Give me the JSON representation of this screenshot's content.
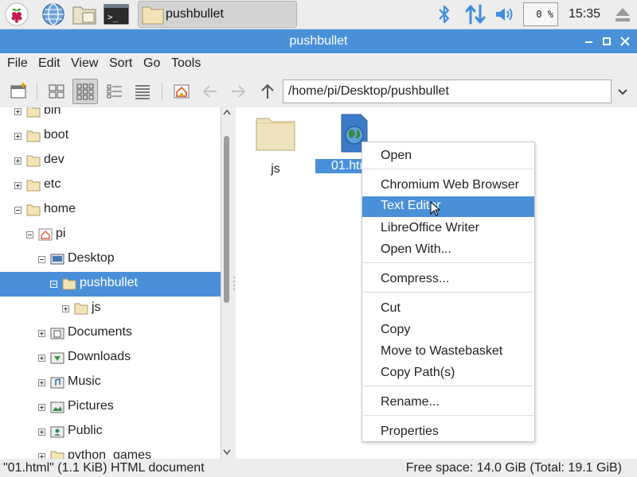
{
  "taskbar": {
    "task_label": "pushbullet",
    "cpu_label": "0 %",
    "clock": "15:35",
    "icons": [
      "raspberry-menu-icon",
      "web-browser-icon",
      "file-manager-icon",
      "terminal-icon",
      "bluetooth-icon",
      "network-icon",
      "volume-icon",
      "eject-icon"
    ]
  },
  "window": {
    "title": "pushbullet",
    "controls": [
      "minimize",
      "maximize",
      "close"
    ]
  },
  "menu": {
    "file": "File",
    "edit": "Edit",
    "view": "View",
    "sort": "Sort",
    "go": "Go",
    "tools": "Tools"
  },
  "toolbar": {
    "path": "/home/pi/Desktop/pushbullet"
  },
  "tree": {
    "items": [
      {
        "label": "bin",
        "expander": "plus"
      },
      {
        "label": "boot",
        "expander": "plus"
      },
      {
        "label": "dev",
        "expander": "plus"
      },
      {
        "label": "etc",
        "expander": "plus"
      },
      {
        "label": "home",
        "expander": "minus"
      },
      {
        "label": "pi",
        "expander": "minus"
      },
      {
        "label": "Desktop",
        "expander": "minus"
      },
      {
        "label": "pushbullet",
        "expander": "minus",
        "selected": true
      },
      {
        "label": "js",
        "expander": "plus"
      },
      {
        "label": "Documents",
        "expander": "plus"
      },
      {
        "label": "Downloads",
        "expander": "plus"
      },
      {
        "label": "Music",
        "expander": "plus"
      },
      {
        "label": "Pictures",
        "expander": "plus"
      },
      {
        "label": "Public",
        "expander": "plus"
      },
      {
        "label": "python_games",
        "expander": "plus"
      }
    ]
  },
  "files": [
    {
      "label": "js",
      "type": "folder"
    },
    {
      "label": "01.htm",
      "type": "html",
      "selected": true
    }
  ],
  "context_menu": {
    "items": [
      {
        "label": "Open"
      },
      {
        "label": "Chromium Web Browser"
      },
      {
        "label": "Text Editor",
        "highlighted": true
      },
      {
        "label": "LibreOffice Writer"
      },
      {
        "label": "Open With..."
      },
      {
        "label": "Compress..."
      },
      {
        "label": "Cut"
      },
      {
        "label": "Copy"
      },
      {
        "label": "Move to Wastebasket"
      },
      {
        "label": "Copy Path(s)"
      },
      {
        "label": "Rename..."
      },
      {
        "label": "Properties"
      }
    ]
  },
  "status": {
    "left": "\"01.html\" (1.1 KiB) HTML document",
    "right": "Free space: 14.0 GiB (Total: 19.1 GiB)"
  },
  "colors": {
    "accent": "#4a90d9",
    "folder": "#f3e4b8",
    "panel": "#ededed"
  }
}
